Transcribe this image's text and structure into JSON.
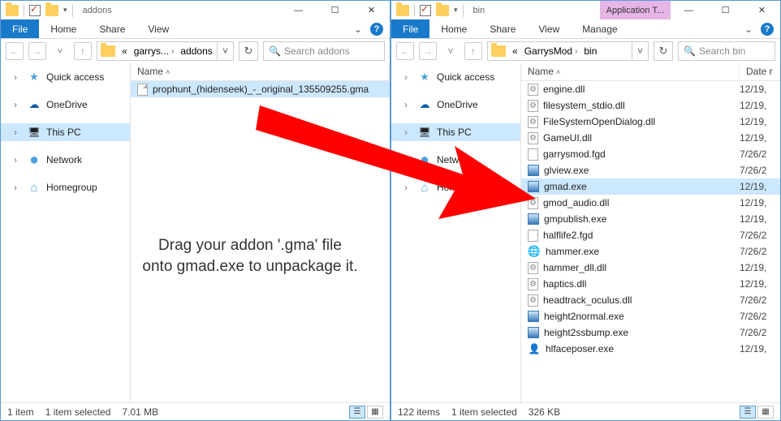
{
  "instruction_line1": "Drag your addon '.gma' file",
  "instruction_line2": "onto gmad.exe to unpackage it.",
  "left": {
    "title": "addons",
    "ribbon": {
      "file": "File",
      "home": "Home",
      "share": "Share",
      "view": "View"
    },
    "crumbs": [
      "«",
      "garrys...",
      "addons"
    ],
    "search_placeholder": "Search addons",
    "columns": {
      "name": "Name"
    },
    "files": [
      {
        "icon": "generic",
        "name": "prophunt_(hidenseek)_-_original_135509255.gma",
        "selected": true
      }
    ],
    "nav": [
      {
        "icon": "star",
        "label": "Quick access"
      },
      {
        "gap": true
      },
      {
        "icon": "cloud",
        "label": "OneDrive"
      },
      {
        "gap": true
      },
      {
        "icon": "pc",
        "label": "This PC",
        "selected": true
      },
      {
        "gap": true
      },
      {
        "icon": "net",
        "label": "Network"
      },
      {
        "gap": true
      },
      {
        "icon": "home",
        "label": "Homegroup"
      }
    ],
    "status": {
      "count": "1 item",
      "sel": "1 item selected",
      "size": "7.01 MB"
    }
  },
  "right": {
    "title": "bin",
    "context_tab": "Application T...",
    "ribbon": {
      "file": "File",
      "home": "Home",
      "share": "Share",
      "view": "View",
      "manage": "Manage"
    },
    "crumbs": [
      "«",
      "GarrysMod",
      "bin"
    ],
    "search_placeholder": "Search bin",
    "columns": {
      "name": "Name",
      "date": "Date r"
    },
    "files": [
      {
        "icon": "dll",
        "name": "engine.dll",
        "date": "12/19,"
      },
      {
        "icon": "dll",
        "name": "filesystem_stdio.dll",
        "date": "12/19,"
      },
      {
        "icon": "dll",
        "name": "FileSystemOpenDialog.dll",
        "date": "12/19,"
      },
      {
        "icon": "dll",
        "name": "GameUI.dll",
        "date": "12/19,"
      },
      {
        "icon": "fgd",
        "name": "garrysmod.fgd",
        "date": "7/26/2"
      },
      {
        "icon": "exe",
        "name": "glview.exe",
        "date": "7/26/2"
      },
      {
        "icon": "exe",
        "name": "gmad.exe",
        "date": "12/19,",
        "selected": true
      },
      {
        "icon": "dll",
        "name": "gmod_audio.dll",
        "date": "12/19,"
      },
      {
        "icon": "exe",
        "name": "gmpublish.exe",
        "date": "12/19,"
      },
      {
        "icon": "fgd",
        "name": "halflife2.fgd",
        "date": "7/26/2"
      },
      {
        "icon": "hammer",
        "name": "hammer.exe",
        "date": "7/26/2"
      },
      {
        "icon": "dll",
        "name": "hammer_dll.dll",
        "date": "12/19,"
      },
      {
        "icon": "dll",
        "name": "haptics.dll",
        "date": "12/19,"
      },
      {
        "icon": "dll",
        "name": "headtrack_oculus.dll",
        "date": "7/26/2"
      },
      {
        "icon": "exe",
        "name": "height2normal.exe",
        "date": "7/26/2"
      },
      {
        "icon": "exe",
        "name": "height2ssbump.exe",
        "date": "7/26/2"
      },
      {
        "icon": "face",
        "name": "hlfaceposer.exe",
        "date": "12/19,"
      }
    ],
    "nav": [
      {
        "icon": "star",
        "label": "Quick access"
      },
      {
        "gap": true
      },
      {
        "icon": "cloud",
        "label": "OneDrive"
      },
      {
        "gap": true
      },
      {
        "icon": "pc",
        "label": "This PC",
        "selected": true
      },
      {
        "gap": true
      },
      {
        "icon": "net",
        "label": "Network"
      },
      {
        "gap": true
      },
      {
        "icon": "home",
        "label": "Homegroup"
      }
    ],
    "status": {
      "count": "122 items",
      "sel": "1 item selected",
      "size": "326 KB"
    }
  }
}
